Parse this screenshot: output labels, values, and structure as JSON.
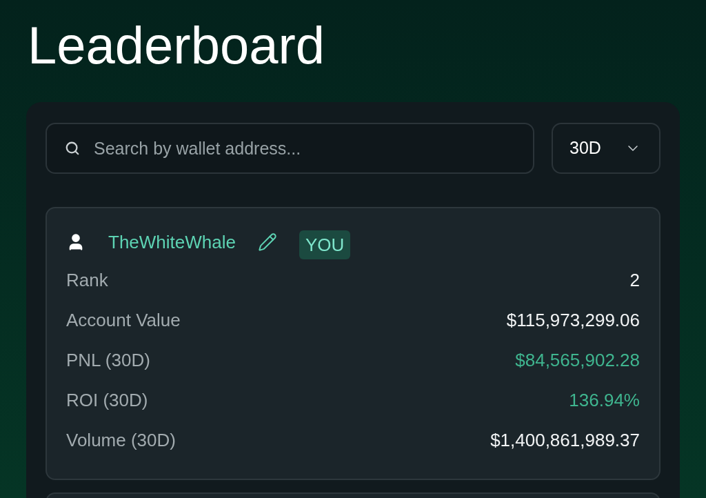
{
  "title": "Leaderboard",
  "search": {
    "placeholder": "Search by wallet address..."
  },
  "period_select": {
    "value": "30D"
  },
  "entry": {
    "name": "TheWhiteWhale",
    "badge": "YOU",
    "stats": [
      {
        "label": "Rank",
        "value": "2",
        "kind": "plain"
      },
      {
        "label": "Account Value",
        "value": "$115,973,299.06",
        "kind": "plain"
      },
      {
        "label": "PNL (30D)",
        "value": "$84,565,902.28",
        "kind": "positive"
      },
      {
        "label": "ROI (30D)",
        "value": "136.94%",
        "kind": "positive"
      },
      {
        "label": "Volume (30D)",
        "value": "$1,400,861,989.37",
        "kind": "plain"
      }
    ]
  }
}
